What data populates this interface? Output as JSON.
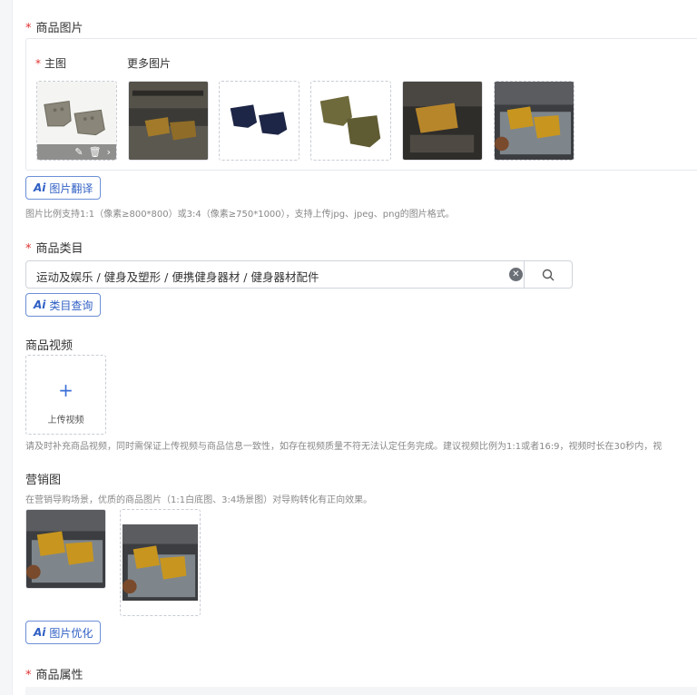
{
  "product_images": {
    "required_mark": "*",
    "label": "商品图片",
    "main_label": "主图",
    "more_label": "更多图片",
    "ai_button": {
      "ai": "Ai",
      "label": "图片翻译"
    },
    "hint": "图片比例支持1:1（像素≥800*800）或3:4（像素≥750*1000），支持上传jpg、jpeg、png的图片格式。"
  },
  "category": {
    "required_mark": "*",
    "label": "商品类目",
    "value": "运动及娱乐 / 健身及塑形 / 便携健身器材 / 健身器材配件",
    "ai_button": {
      "ai": "Ai",
      "label": "类目查询"
    }
  },
  "video": {
    "label": "商品视频",
    "upload_plus": "+",
    "upload_label": "上传视频",
    "hint": "请及时补充商品视频，同时需保证上传视频与商品信息一致性，如存在视频质量不符无法认定任务完成。建议视频比例为1:1或者16:9，视频时长在30秒内，视"
  },
  "marketing": {
    "label": "营销图",
    "hint": "在营销导购场景，优质的商品图片（1:1白底图、3:4场景图）对导购转化有正向效果。",
    "ai_button": {
      "ai": "Ai",
      "label": "图片优化"
    }
  },
  "attributes": {
    "required_mark": "*",
    "label": "商品属性"
  },
  "colors": {
    "required": "#e03131",
    "accent": "#2f5fc4",
    "product_gray": "#8a8679",
    "product_navy": "#1e2647",
    "product_olive": "#6e6a3c",
    "product_mustard": "#c8961f"
  }
}
